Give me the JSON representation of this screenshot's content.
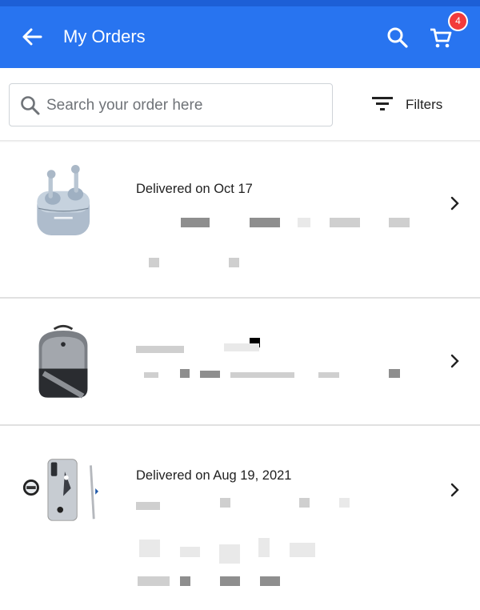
{
  "header": {
    "title": "My Orders",
    "cart_count": "4",
    "colors": {
      "primary": "#2874f0",
      "badge": "#f23b3b"
    }
  },
  "search": {
    "placeholder": "Search your order here",
    "value": ""
  },
  "filters": {
    "label": "Filters"
  },
  "orders": [
    {
      "product": "wireless earbuds",
      "status": "Delivered on Oct 17"
    },
    {
      "product": "backpack",
      "status": ""
    },
    {
      "product": "phone case and grip",
      "status": "Delivered on Aug 19, 2021"
    }
  ],
  "icons": [
    "back-arrow-icon",
    "search-icon",
    "cart-icon",
    "filter-icon",
    "chevron-right-icon"
  ]
}
